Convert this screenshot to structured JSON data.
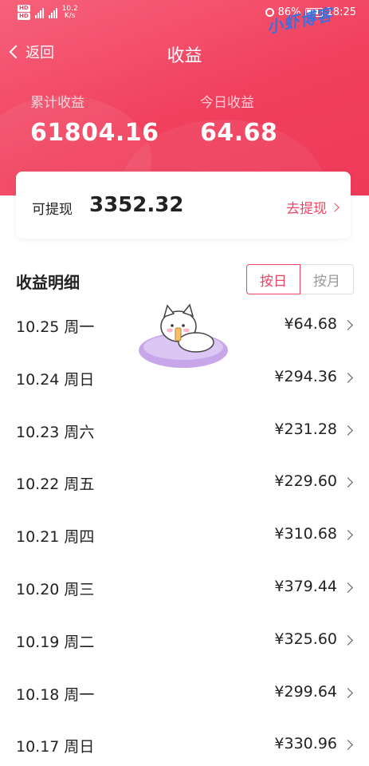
{
  "status_bar": {
    "network_speed": "10.2\nK/s",
    "battery": "86%",
    "time": "18:25"
  },
  "watermark": "小虾博客",
  "nav": {
    "back_label": "返回",
    "title": "收益"
  },
  "stats": {
    "total_label": "累计收益",
    "total_value": "61804.16",
    "today_label": "今日收益",
    "today_value": "64.68"
  },
  "withdraw": {
    "label": "可提现",
    "value": "3352.32",
    "action": "去提现"
  },
  "detail": {
    "title": "收益明细",
    "toggle": {
      "day": "按日",
      "month": "按月"
    },
    "rows": [
      {
        "date": "10.25 周一",
        "amount": "¥64.68"
      },
      {
        "date": "10.24 周日",
        "amount": "¥294.36"
      },
      {
        "date": "10.23 周六",
        "amount": "¥231.28"
      },
      {
        "date": "10.22 周五",
        "amount": "¥229.60"
      },
      {
        "date": "10.21 周四",
        "amount": "¥310.68"
      },
      {
        "date": "10.20 周三",
        "amount": "¥379.44"
      },
      {
        "date": "10.19 周二",
        "amount": "¥325.60"
      },
      {
        "date": "10.18 周一",
        "amount": "¥299.64"
      },
      {
        "date": "10.17 周日",
        "amount": "¥330.96"
      }
    ]
  },
  "colors": {
    "accent": "#ef4562",
    "header_bg": "#f0405e",
    "watermark": "#3f6fd8"
  }
}
